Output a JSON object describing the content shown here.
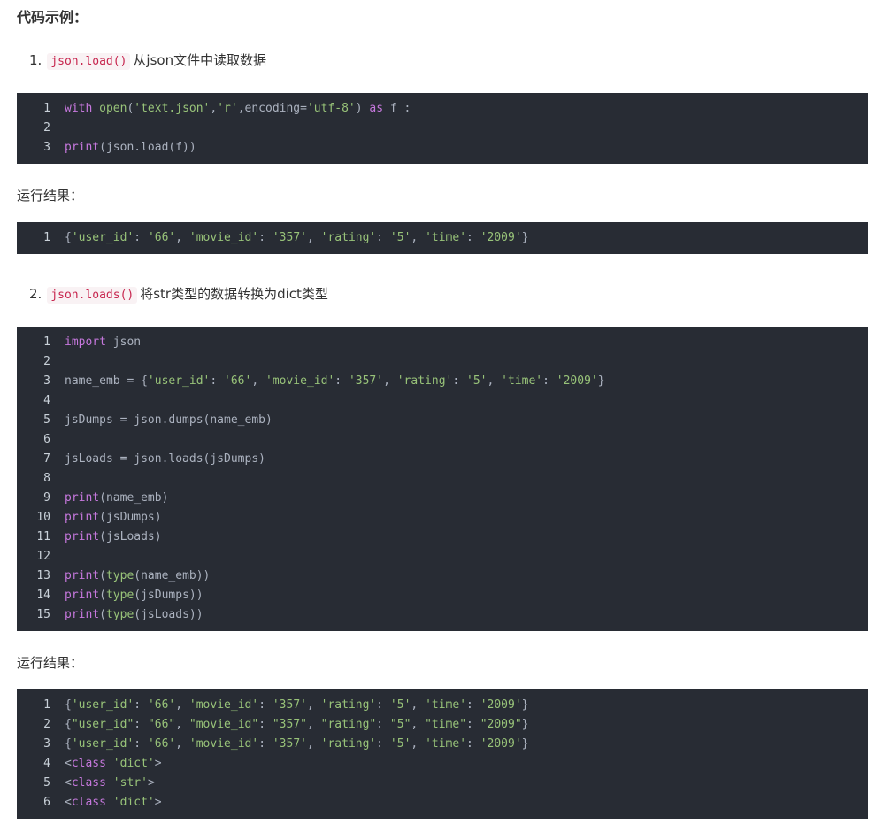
{
  "heading": "代码示例：",
  "section1": {
    "number": "1.",
    "code": "json.load()",
    "desc": "从json文件中读取数据"
  },
  "section2": {
    "number": "2.",
    "code": "json.loads()",
    "desc": "将str类型的数据转换为dict类型"
  },
  "result_label_1": "运行结果：",
  "result_label_2": "运行结果：",
  "colors": {
    "code_bg": "#282c34",
    "keyword": "#c678dd",
    "string": "#98c379",
    "inline_code": "#c7254e"
  },
  "code1": [
    [
      [
        "kw",
        "with"
      ],
      [
        "tx",
        " "
      ],
      [
        "fn",
        "open"
      ],
      [
        "tx",
        "("
      ],
      [
        "str",
        "'text.json'"
      ],
      [
        "tx",
        ","
      ],
      [
        "str",
        "'r'"
      ],
      [
        "tx",
        ",encoding="
      ],
      [
        "str",
        "'utf-8'"
      ],
      [
        "tx",
        ") "
      ],
      [
        "kw",
        "as"
      ],
      [
        "tx",
        " f :"
      ]
    ],
    [],
    [
      [
        "kw",
        "print"
      ],
      [
        "tx",
        "(json.load(f))"
      ]
    ]
  ],
  "out1": [
    [
      [
        "tx",
        "{"
      ],
      [
        "str",
        "'user_id'"
      ],
      [
        "tx",
        ": "
      ],
      [
        "str",
        "'66'"
      ],
      [
        "tx",
        ", "
      ],
      [
        "str",
        "'movie_id'"
      ],
      [
        "tx",
        ": "
      ],
      [
        "str",
        "'357'"
      ],
      [
        "tx",
        ", "
      ],
      [
        "str",
        "'rating'"
      ],
      [
        "tx",
        ": "
      ],
      [
        "str",
        "'5'"
      ],
      [
        "tx",
        ", "
      ],
      [
        "str",
        "'time'"
      ],
      [
        "tx",
        ": "
      ],
      [
        "str",
        "'2009'"
      ],
      [
        "tx",
        "}"
      ]
    ]
  ],
  "code2": [
    [
      [
        "kw",
        "import"
      ],
      [
        "tx",
        " json"
      ]
    ],
    [],
    [
      [
        "tx",
        "name_emb = {"
      ],
      [
        "str",
        "'user_id'"
      ],
      [
        "tx",
        ": "
      ],
      [
        "str",
        "'66'"
      ],
      [
        "tx",
        ", "
      ],
      [
        "str",
        "'movie_id'"
      ],
      [
        "tx",
        ": "
      ],
      [
        "str",
        "'357'"
      ],
      [
        "tx",
        ", "
      ],
      [
        "str",
        "'rating'"
      ],
      [
        "tx",
        ": "
      ],
      [
        "str",
        "'5'"
      ],
      [
        "tx",
        ", "
      ],
      [
        "str",
        "'time'"
      ],
      [
        "tx",
        ": "
      ],
      [
        "str",
        "'2009'"
      ],
      [
        "tx",
        "}"
      ]
    ],
    [],
    [
      [
        "tx",
        "jsDumps = json.dumps(name_emb)"
      ]
    ],
    [],
    [
      [
        "tx",
        "jsLoads = json.loads(jsDumps)"
      ]
    ],
    [],
    [
      [
        "kw",
        "print"
      ],
      [
        "tx",
        "(name_emb)"
      ]
    ],
    [
      [
        "kw",
        "print"
      ],
      [
        "tx",
        "(jsDumps)"
      ]
    ],
    [
      [
        "kw",
        "print"
      ],
      [
        "tx",
        "(jsLoads)"
      ]
    ],
    [],
    [
      [
        "kw",
        "print"
      ],
      [
        "tx",
        "("
      ],
      [
        "fn",
        "type"
      ],
      [
        "tx",
        "(name_emb))"
      ]
    ],
    [
      [
        "kw",
        "print"
      ],
      [
        "tx",
        "("
      ],
      [
        "fn",
        "type"
      ],
      [
        "tx",
        "(jsDumps))"
      ]
    ],
    [
      [
        "kw",
        "print"
      ],
      [
        "tx",
        "("
      ],
      [
        "fn",
        "type"
      ],
      [
        "tx",
        "(jsLoads))"
      ]
    ]
  ],
  "out2": [
    [
      [
        "tx",
        "{"
      ],
      [
        "str",
        "'user_id'"
      ],
      [
        "tx",
        ": "
      ],
      [
        "str",
        "'66'"
      ],
      [
        "tx",
        ", "
      ],
      [
        "str",
        "'movie_id'"
      ],
      [
        "tx",
        ": "
      ],
      [
        "str",
        "'357'"
      ],
      [
        "tx",
        ", "
      ],
      [
        "str",
        "'rating'"
      ],
      [
        "tx",
        ": "
      ],
      [
        "str",
        "'5'"
      ],
      [
        "tx",
        ", "
      ],
      [
        "str",
        "'time'"
      ],
      [
        "tx",
        ": "
      ],
      [
        "str",
        "'2009'"
      ],
      [
        "tx",
        "}"
      ]
    ],
    [
      [
        "tx",
        "{"
      ],
      [
        "str",
        "\"user_id\""
      ],
      [
        "tx",
        ": "
      ],
      [
        "str",
        "\"66\""
      ],
      [
        "tx",
        ", "
      ],
      [
        "str",
        "\"movie_id\""
      ],
      [
        "tx",
        ": "
      ],
      [
        "str",
        "\"357\""
      ],
      [
        "tx",
        ", "
      ],
      [
        "str",
        "\"rating\""
      ],
      [
        "tx",
        ": "
      ],
      [
        "str",
        "\"5\""
      ],
      [
        "tx",
        ", "
      ],
      [
        "str",
        "\"time\""
      ],
      [
        "tx",
        ": "
      ],
      [
        "str",
        "\"2009\""
      ],
      [
        "tx",
        "}"
      ]
    ],
    [
      [
        "tx",
        "{"
      ],
      [
        "str",
        "'user_id'"
      ],
      [
        "tx",
        ": "
      ],
      [
        "str",
        "'66'"
      ],
      [
        "tx",
        ", "
      ],
      [
        "str",
        "'movie_id'"
      ],
      [
        "tx",
        ": "
      ],
      [
        "str",
        "'357'"
      ],
      [
        "tx",
        ", "
      ],
      [
        "str",
        "'rating'"
      ],
      [
        "tx",
        ": "
      ],
      [
        "str",
        "'5'"
      ],
      [
        "tx",
        ", "
      ],
      [
        "str",
        "'time'"
      ],
      [
        "tx",
        ": "
      ],
      [
        "str",
        "'2009'"
      ],
      [
        "tx",
        "}"
      ]
    ],
    [
      [
        "tx",
        "<"
      ],
      [
        "kw",
        "class"
      ],
      [
        "tx",
        " "
      ],
      [
        "str",
        "'dict'"
      ],
      [
        "tx",
        ">"
      ]
    ],
    [
      [
        "tx",
        "<"
      ],
      [
        "kw",
        "class"
      ],
      [
        "tx",
        " "
      ],
      [
        "str",
        "'str'"
      ],
      [
        "tx",
        ">"
      ]
    ],
    [
      [
        "tx",
        "<"
      ],
      [
        "kw",
        "class"
      ],
      [
        "tx",
        " "
      ],
      [
        "str",
        "'dict'"
      ],
      [
        "tx",
        ">"
      ]
    ]
  ]
}
